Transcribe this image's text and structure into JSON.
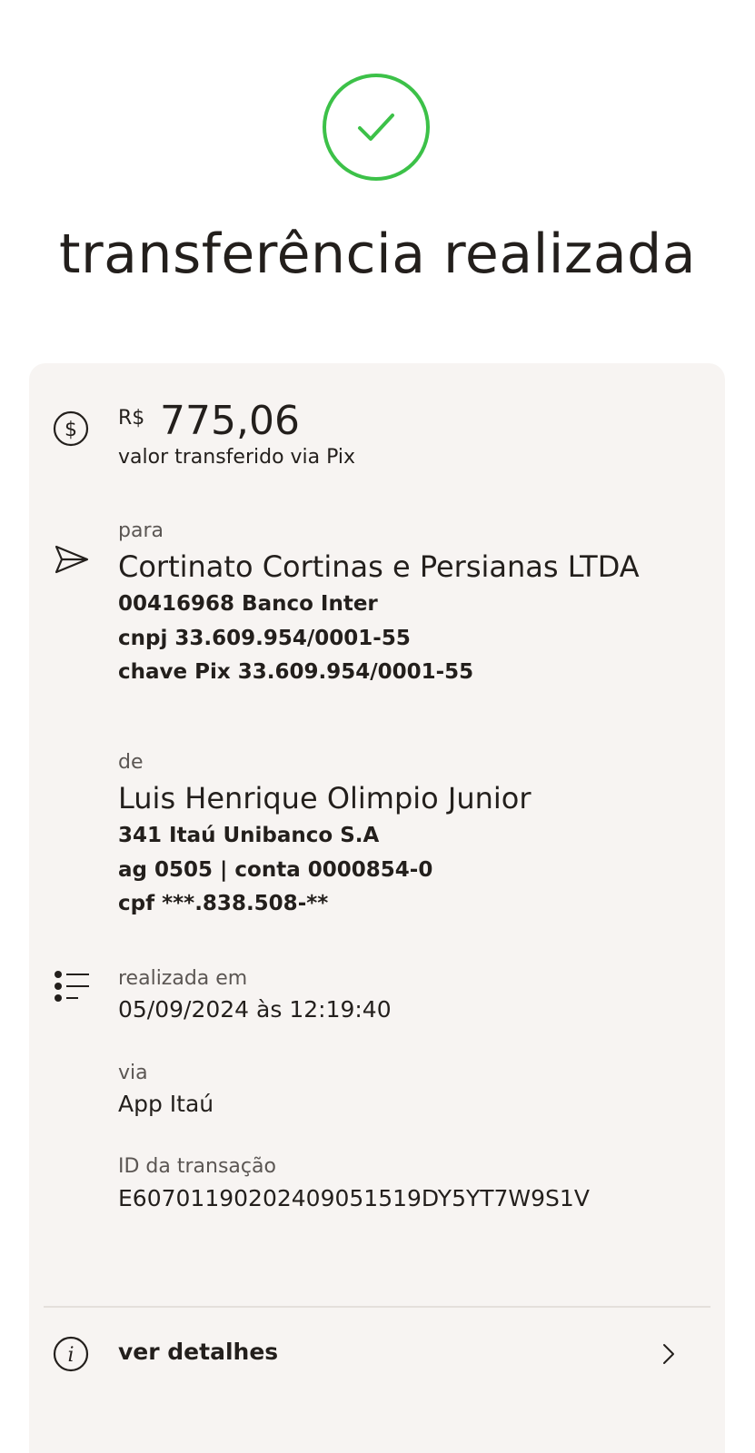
{
  "header": {
    "title": "transferência realizada"
  },
  "amount": {
    "currency": "R$",
    "value": "775,06",
    "label": "valor transferido via Pix"
  },
  "recipient": {
    "label": "para",
    "name": "Cortinato Cortinas e Persianas LTDA",
    "bank": "00416968 Banco Inter",
    "document": "cnpj 33.609.954/0001-55",
    "pix_key": "chave Pix 33.609.954/0001-55"
  },
  "sender": {
    "label": "de",
    "name": "Luis Henrique Olimpio Junior",
    "bank": "341 Itaú Unibanco S.A",
    "account": "ag 0505 | conta 0000854-0",
    "document": "cpf ***.838.508-**"
  },
  "transaction": {
    "date_label": "realizada em",
    "date_value": "05/09/2024 às 12:19:40",
    "via_label": "via",
    "via_value": "App Itaú",
    "id_label": "ID da transação",
    "id_value": "E60701190202409051519DY5YT7W9S1V"
  },
  "footer": {
    "details_label": "ver detalhes"
  },
  "icons": {
    "success": "check-circle-icon",
    "amount": "dollar-circle-icon",
    "recipient": "send-icon",
    "transaction": "list-icon",
    "details": "info-icon",
    "chevron": "chevron-right-icon"
  },
  "colors": {
    "success": "#3cc148",
    "card_background": "#f7f4f2",
    "text": "#231f1c",
    "muted": "#5b5653"
  }
}
